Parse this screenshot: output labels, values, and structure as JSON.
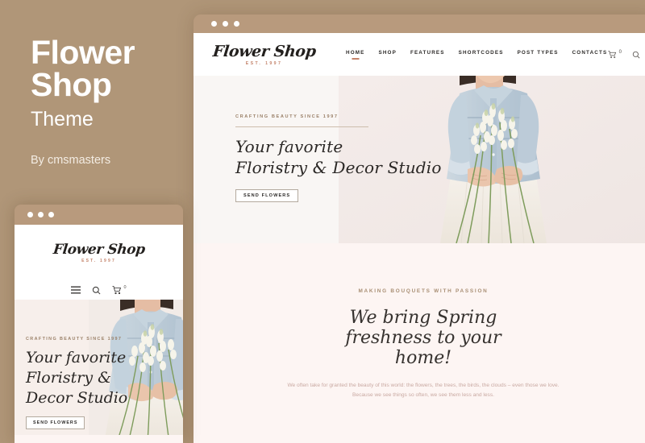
{
  "promo": {
    "title_line1": "Flower",
    "title_line2": "Shop",
    "subtitle": "Theme",
    "author": "By cmsmasters"
  },
  "colors": {
    "page_background": "#b09678",
    "chrome_bar": "#b89a7d",
    "accent": "#c4836a",
    "hero_background": "#f9f6f4",
    "section_background": "#fdf5f3",
    "body_text": "#c9a9a2"
  },
  "desktop": {
    "window_dots": [
      "dot-1",
      "dot-2",
      "dot-3"
    ],
    "logo": {
      "name": "Flower Shop",
      "established": "EST. 1997"
    },
    "nav": [
      {
        "label": "HOME",
        "active": true
      },
      {
        "label": "SHOP",
        "active": false
      },
      {
        "label": "FEATURES",
        "active": false
      },
      {
        "label": "SHORTCODES",
        "active": false
      },
      {
        "label": "POST TYPES",
        "active": false
      },
      {
        "label": "CONTACTS",
        "active": false
      }
    ],
    "tools": {
      "cart_icon": "cart-icon",
      "cart_count": "0",
      "search_icon": "search-icon"
    },
    "hero": {
      "eyebrow": "CRAFTING BEAUTY SINCE 1997",
      "title_line1": "Your favorite",
      "title_line2": "Floristry & Decor Studio",
      "button": "SEND FLOWERS",
      "photo_alt": "woman-holding-flowers-photo"
    },
    "section2": {
      "eyebrow": "MAKING BOUQUETS WITH PASSION",
      "title_line1": "We bring Spring",
      "title_line2": "freshness to your",
      "title_line3": "home!",
      "body": "We often take for granted the beauty of this world: the flowers, the trees, the birds, the clouds – even those we love. Because we see things so often, we see them less and less."
    }
  },
  "mobile": {
    "window_dots": [
      "dot-1",
      "dot-2",
      "dot-3"
    ],
    "logo": {
      "name": "Flower Shop",
      "established": "EST. 1997"
    },
    "tools": {
      "menu_icon": "hamburger-menu-icon",
      "search_icon": "search-icon",
      "cart_icon": "cart-icon",
      "cart_count": "0"
    },
    "hero": {
      "eyebrow": "CRAFTING BEAUTY SINCE 1997",
      "title_line1": "Your favorite",
      "title_line2": "Floristry &",
      "title_line3": "Decor Studio",
      "button": "SEND FLOWERS",
      "photo_alt": "woman-holding-flowers-photo"
    }
  }
}
